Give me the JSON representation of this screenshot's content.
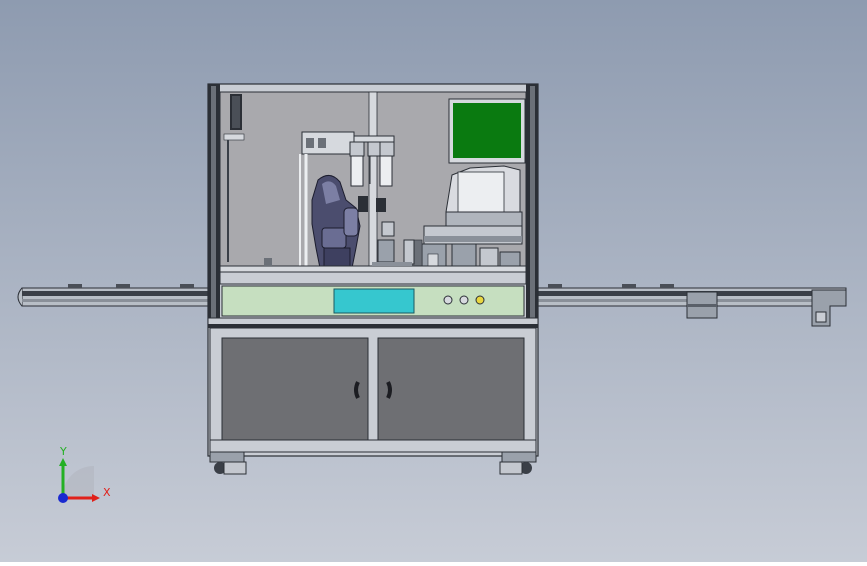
{
  "viewport": {
    "background_top": "#8e9bb0",
    "background_bottom": "#c7ccd6"
  },
  "colors": {
    "frame": "#c9cdd4",
    "frame_dark": "#2b2f36",
    "glass": "#a9a9ad",
    "cabinet_door": "#6e6f73",
    "panel_green": "#c6dfc0",
    "display_cyan": "#36c7cf",
    "monitor_green": "#0a7a10",
    "conveyor": "#b8bec6"
  },
  "triad": {
    "x_label": "X",
    "y_label": "Y",
    "x_color": "#e0201a",
    "y_color": "#24b024",
    "z_color": "#1a2ad0"
  }
}
